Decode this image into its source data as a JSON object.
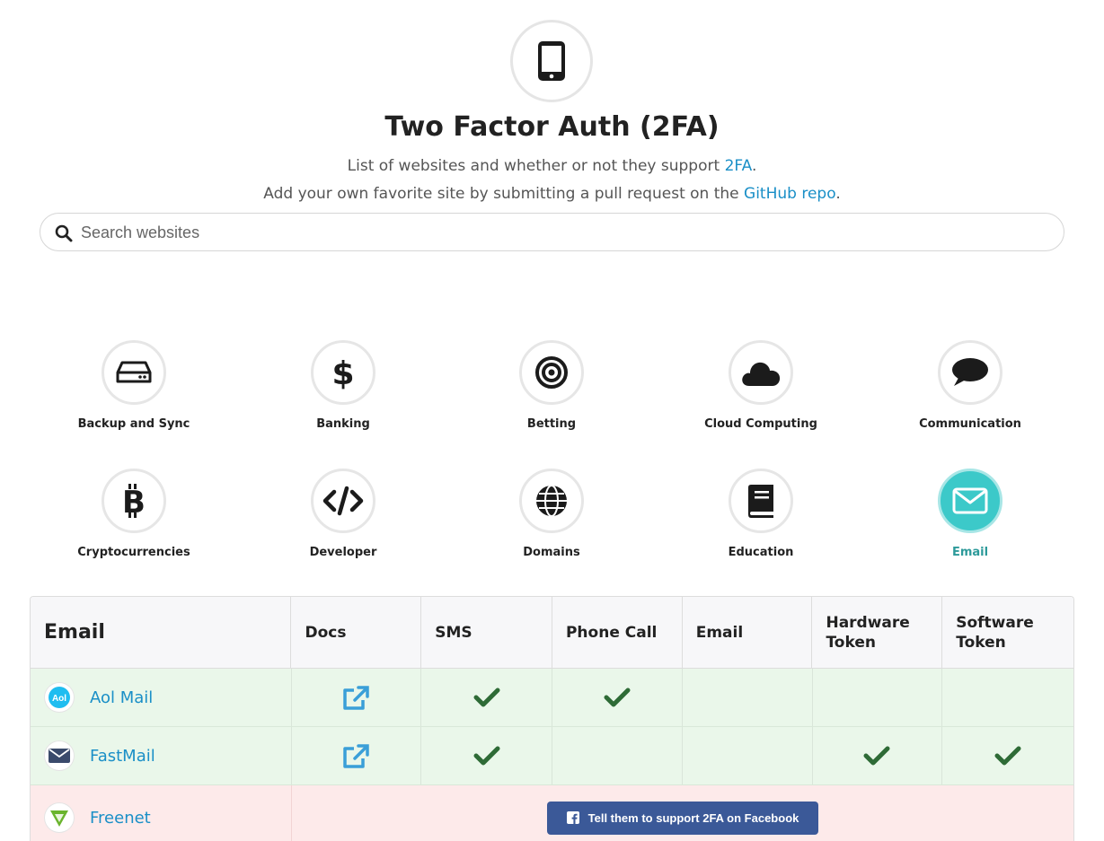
{
  "header": {
    "title": "Two Factor Auth (2FA)",
    "line1_prefix": "List of websites and whether or not they support ",
    "line1_link": "2FA",
    "line1_suffix": ".",
    "line2_prefix": "Add your own favorite site by submitting a pull request on the ",
    "line2_link": "GitHub repo",
    "line2_suffix": ".",
    "hero_icon": "mobile-phone-icon"
  },
  "search": {
    "placeholder": "Search websites",
    "value": ""
  },
  "categories": [
    {
      "label": "Backup and Sync",
      "icon": "hard-drive-icon"
    },
    {
      "label": "Banking",
      "icon": "dollar-icon"
    },
    {
      "label": "Betting",
      "icon": "bullseye-icon"
    },
    {
      "label": "Cloud Computing",
      "icon": "cloud-icon"
    },
    {
      "label": "Communication",
      "icon": "speech-bubble-icon"
    },
    {
      "label": "Cryptocurrencies",
      "icon": "bitcoin-icon"
    },
    {
      "label": "Developer",
      "icon": "code-icon"
    },
    {
      "label": "Domains",
      "icon": "globe-icon"
    },
    {
      "label": "Education",
      "icon": "book-icon"
    },
    {
      "label": "Email",
      "icon": "envelope-icon",
      "active": true
    }
  ],
  "table": {
    "headers": [
      "Email",
      "Docs",
      "SMS",
      "Phone Call",
      "Email",
      "Hardware Token",
      "Software Token"
    ],
    "rows": [
      {
        "name": "Aol Mail",
        "docs": true,
        "sms": true,
        "phone": true,
        "email": false,
        "hardware": false,
        "software": false
      },
      {
        "name": "FastMail",
        "docs": true,
        "sms": true,
        "phone": false,
        "email": false,
        "hardware": true,
        "software": true
      },
      {
        "name": "Freenet",
        "unsupported": true,
        "cta": "Tell them to support 2FA on Facebook"
      }
    ]
  },
  "colors": {
    "accent": "#3cc9c9",
    "link": "#1a8fc7",
    "check": "#2e6b36",
    "supported_row": "#eaf7ea",
    "unsupported_row": "#fdeaea",
    "facebook": "#3b5998"
  }
}
